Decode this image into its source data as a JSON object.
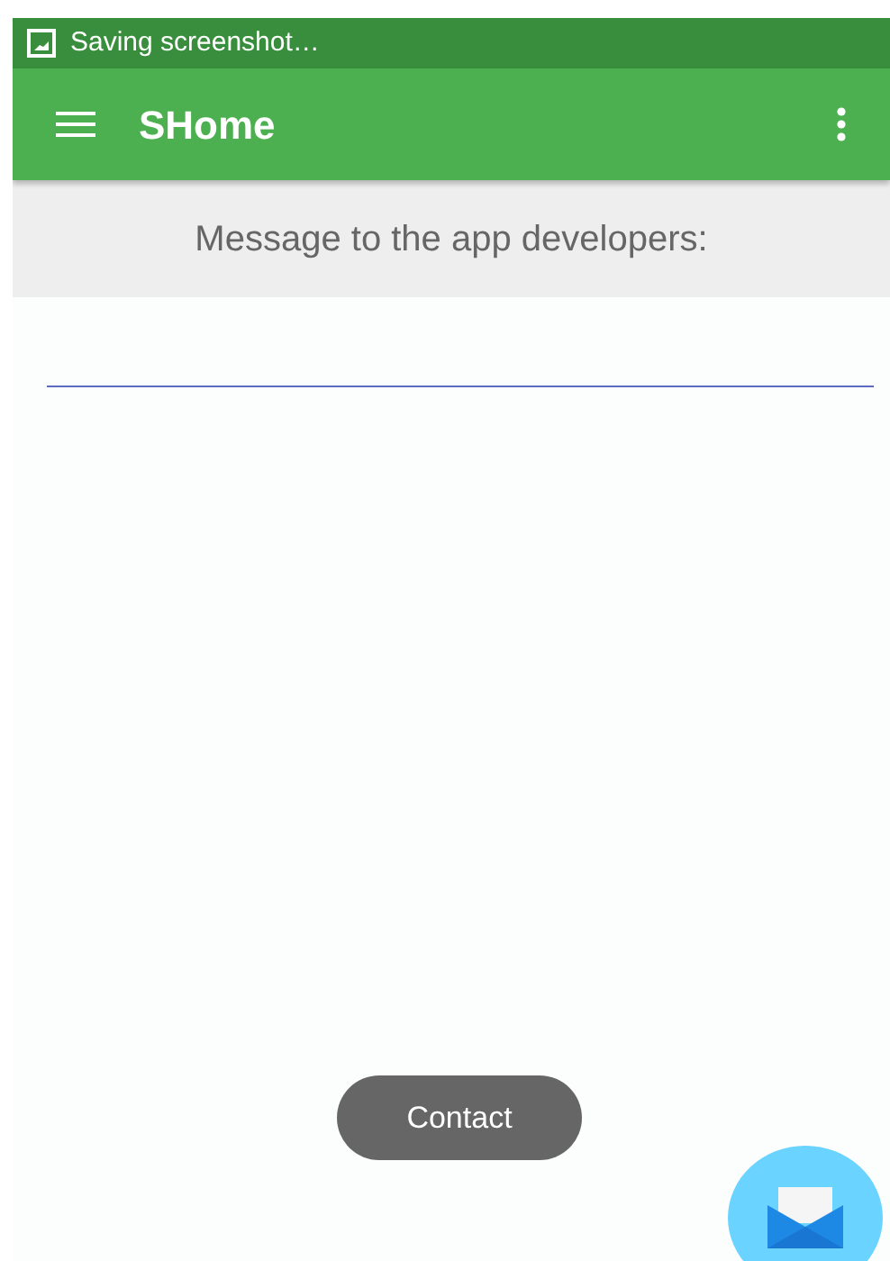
{
  "status_bar": {
    "notification": "Saving screenshot…"
  },
  "app_bar": {
    "title": "SHome"
  },
  "header": {
    "text": "Message to the app developers:"
  },
  "toast": {
    "text": "Contact"
  }
}
